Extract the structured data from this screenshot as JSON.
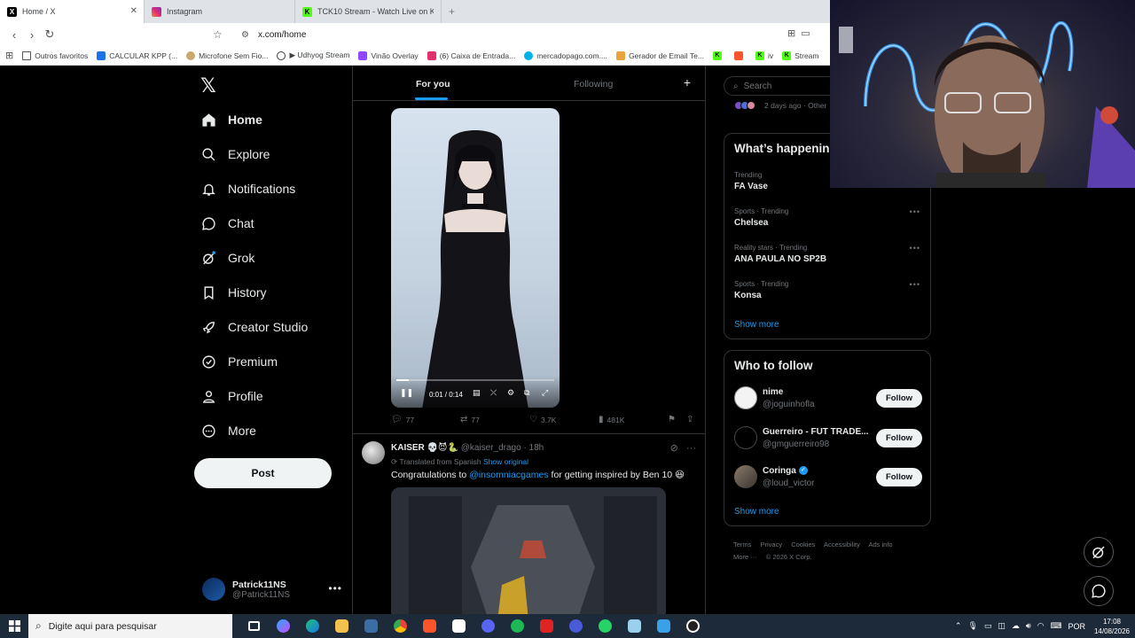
{
  "browser": {
    "tabs": [
      {
        "title": "Home / X",
        "icon": "x-icon",
        "active": true
      },
      {
        "title": "Instagram",
        "icon": "instagram-icon",
        "active": false
      },
      {
        "title": "TCK10 Stream - Watch Live on Kick",
        "icon": "kick-icon",
        "active": false
      }
    ],
    "url": "x.com/home",
    "bookmarks": [
      {
        "label": "Outros favoritos",
        "icon": "folder-icon",
        "color": "#555555"
      },
      {
        "label": "CALCULAR KPP (...",
        "icon": "table-icon",
        "color": "#1a73e8"
      },
      {
        "label": "Microfone Sem Fio...",
        "icon": "mic-icon",
        "color": "#c9a96e"
      },
      {
        "label": "▶ Udhyog Stream",
        "icon": "globe-icon",
        "color": "#3c4043"
      },
      {
        "label": "Vinão Overlay",
        "icon": "twitch-icon",
        "color": "#9146ff"
      },
      {
        "label": "(6) Caixa de Entrada...",
        "icon": "instagram-icon",
        "color": "#e1306c"
      },
      {
        "label": "mercadopago.com....",
        "icon": "mercadopago-icon",
        "color": "#00b1ea"
      },
      {
        "label": "Gerador de Email Te...",
        "icon": "pen-icon",
        "color": "#e8a33d"
      },
      {
        "label": "",
        "icon": "kick-icon",
        "color": "#53fc18"
      },
      {
        "label": "",
        "icon": "brave-icon",
        "color": "#fb542b"
      },
      {
        "label": "iv",
        "icon": "kick-icon",
        "color": "#53fc18"
      },
      {
        "label": "Stream",
        "icon": "kick-icon",
        "color": "#53fc18"
      }
    ]
  },
  "x": {
    "nav": [
      {
        "label": "Home",
        "icon": "home-icon"
      },
      {
        "label": "Explore",
        "icon": "search-icon"
      },
      {
        "label": "Notifications",
        "icon": "bell-icon"
      },
      {
        "label": "Chat",
        "icon": "chat-icon"
      },
      {
        "label": "Grok",
        "icon": "grok-icon"
      },
      {
        "label": "History",
        "icon": "bookmark-icon"
      },
      {
        "label": "Creator Studio",
        "icon": "rocket-icon"
      },
      {
        "label": "Premium",
        "icon": "premium-icon"
      },
      {
        "label": "Profile",
        "icon": "person-icon"
      },
      {
        "label": "More",
        "icon": "more-circle-icon"
      }
    ],
    "post_label": "Post",
    "account": {
      "name": "Patrick11NS",
      "handle": "@Patrick11NS"
    },
    "feed_tabs": {
      "for_you": "For you",
      "following": "Following"
    },
    "video": {
      "time": "0:01 / 0:14",
      "progress": 0.08
    },
    "tweet1_actions": {
      "replies": "77",
      "reposts": "77",
      "likes": "3.7K",
      "views": "481K"
    },
    "tweet2": {
      "name": "KAISER",
      "emojis": "💀😈🐍",
      "handle": "@kaiser_drago",
      "time": "18h",
      "translated": "Translated from Spanish",
      "show_original": "Show original",
      "text_before": "Congratulations to",
      "mention": "@insomniacgames",
      "text_after": "for getting inspired by Ben 10 😆"
    },
    "search_placeholder": "Search",
    "strip_text": "2 days ago · Other",
    "happening_title": "What’s happening",
    "trends": [
      {
        "context": "Trending",
        "title": "FA Vase"
      },
      {
        "context": "Sports · Trending",
        "title": "Chelsea"
      },
      {
        "context": "Reality stars · Trending",
        "title": "ANA PAULA NO SP2B"
      },
      {
        "context": "Sports · Trending",
        "title": "Konsa"
      }
    ],
    "show_more": "Show more",
    "who_to_follow_title": "Who to follow",
    "follow_suggestions": [
      {
        "name": "nime",
        "handle": "@joguinhofla",
        "verified": false
      },
      {
        "name": "Guerreiro - FUT TRADE...",
        "handle": "@gmguerreiro98",
        "verified": false
      },
      {
        "name": "Coringa",
        "handle": "@loud_victor",
        "verified": true
      }
    ],
    "follow_label": "Follow",
    "footer": [
      "Terms",
      "Privacy",
      "Cookies",
      "Accessibility",
      "Ads info",
      "More ···",
      "© 2026 X Corp."
    ]
  },
  "taskbar": {
    "search_placeholder": "Digite aqui para pesquisar",
    "lang": "POR",
    "time": "17:08",
    "date": "14/08/2026"
  }
}
